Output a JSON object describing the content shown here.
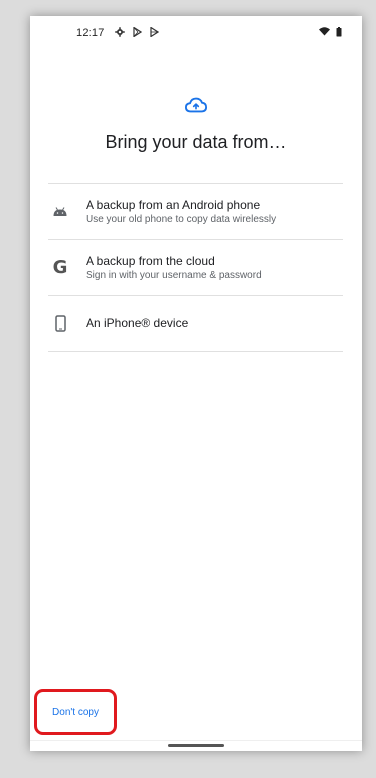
{
  "status_bar": {
    "time": "12:17",
    "left_icons": [
      "settings-icon",
      "play-store-icon",
      "play-store-outline-icon"
    ],
    "right_icons": [
      "wifi-icon",
      "battery-icon"
    ]
  },
  "header": {
    "icon": "cloud-upload-icon",
    "title": "Bring your data from…"
  },
  "options": [
    {
      "icon": "android-icon",
      "title": "A backup from an Android phone",
      "subtitle": "Use your old phone to copy data wirelessly"
    },
    {
      "icon": "google-icon",
      "icon_glyph": "G",
      "title": "A backup from the cloud",
      "subtitle": "Sign in with your username & password"
    },
    {
      "icon": "phone-icon",
      "title": "An iPhone® device",
      "subtitle": ""
    }
  ],
  "footer": {
    "dont_copy_label": "Don't copy"
  },
  "colors": {
    "accent": "#1a73e8",
    "highlight": "#e0191e"
  }
}
